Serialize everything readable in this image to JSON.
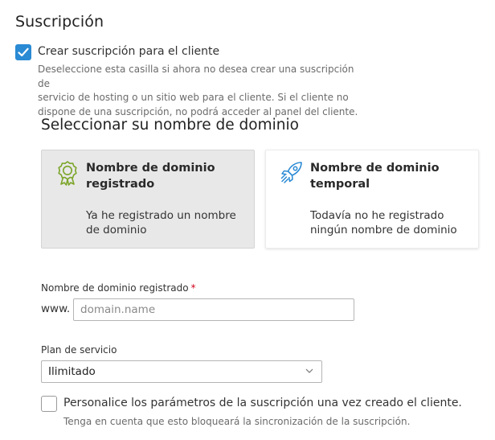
{
  "section": {
    "title": "Suscripción"
  },
  "create_subscription": {
    "checked": true,
    "label": "Crear suscripción para el cliente",
    "hint_lines": [
      "Deseleccione esta casilla si ahora no desea crear una suscripción de",
      "servicio de hosting o un sitio web para el cliente. Si el cliente no",
      "dispone de una suscripción, no podrá acceder al panel del cliente."
    ]
  },
  "domain_choice": {
    "title": "Seleccionar su nombre de dominio",
    "options": [
      {
        "icon": "award-ribbon-icon",
        "title_lines": [
          "Nombre de dominio",
          "registrado"
        ],
        "desc_lines": [
          "Ya he registrado un nombre",
          "de dominio"
        ],
        "selected": true
      },
      {
        "icon": "rocket-icon",
        "title_lines": [
          "Nombre de dominio",
          "temporal"
        ],
        "desc_lines": [
          "Todavía no he registrado",
          "ningún nombre de dominio"
        ],
        "selected": false
      }
    ]
  },
  "domain_field": {
    "label": "Nombre de dominio registrado",
    "required_mark": "*",
    "prefix": "www.",
    "value": "",
    "placeholder": "domain.name"
  },
  "plan_field": {
    "label": "Plan de servicio",
    "selected": "Ilimitado"
  },
  "customize": {
    "checked": false,
    "label": "Personalice los parámetros de la suscripción una vez creado el cliente.",
    "hint": "Tenga en cuenta que esto bloqueará la sincronización de la suscripción."
  },
  "colors": {
    "checkbox_accent": "#2a8ad4",
    "icon_green": "#7ba529",
    "icon_blue": "#2a8ad4",
    "required": "#d0021b"
  }
}
